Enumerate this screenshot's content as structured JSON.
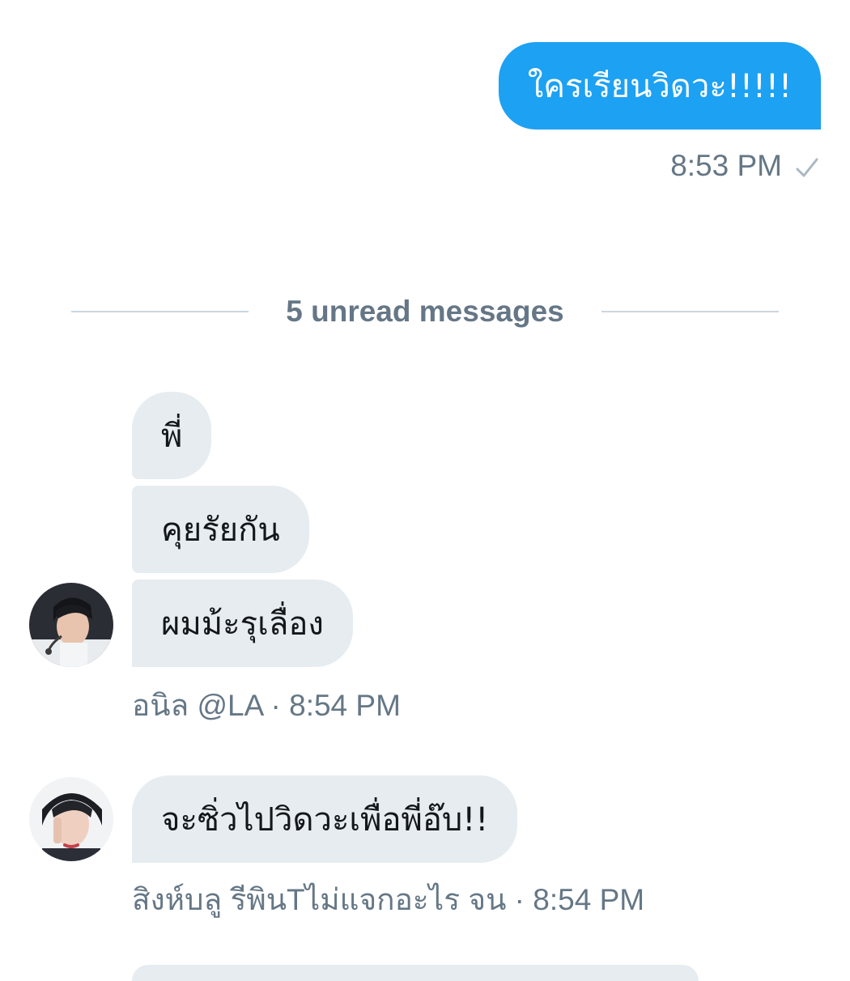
{
  "conversation": {
    "outgoing": {
      "text": "ใครเรียนวิดวะ!!!!!",
      "time": "8:53 PM",
      "status_icon": "sent-check-icon"
    },
    "unread_divider": "5 unread messages",
    "groups": [
      {
        "messages": [
          "พี่",
          "คุยรัยกัน",
          "ผมม้ะรุเลื่อง"
        ],
        "meta": "อนิล @LA · 8:54 PM",
        "avatar": "user-avatar-1"
      },
      {
        "messages": [
          "จะซิ่วไปวิดวะเพื่อพี่อ๊บ!!"
        ],
        "meta": "สิงห์บลู รีพินTไม่แจกอะไร จน · 8:54 PM",
        "avatar": "user-avatar-2"
      }
    ]
  },
  "colors": {
    "outgoing_bubble": "#1da1f2",
    "incoming_bubble": "#e6ecf0",
    "meta_text": "#657786",
    "divider_line": "#ccd6dd"
  }
}
